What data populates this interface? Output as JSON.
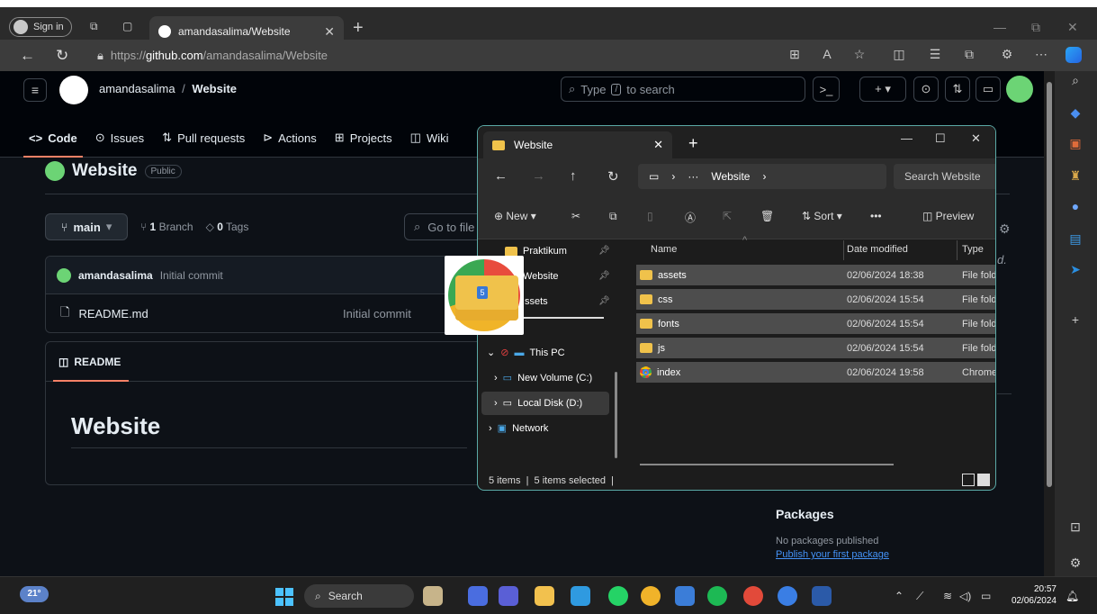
{
  "browser": {
    "sign_in": "Sign in",
    "tab_title": "amandasalima/Website",
    "url_prefix": "https://",
    "url_host": "github.com",
    "url_path": "/amandasalima/Website"
  },
  "github": {
    "owner": "amandasalima",
    "slash": "/",
    "repo": "Website",
    "search_placeholder": "Type",
    "search_kbd": "/",
    "search_suffix": "to search",
    "nav": [
      "Code",
      "Issues",
      "Pull requests",
      "Actions",
      "Projects",
      "Wiki"
    ],
    "visibility": "Public",
    "branch": "main",
    "branches_count": "1",
    "branches_label": "Branch",
    "tags_count": "0",
    "tags_label": "Tags",
    "go_to_file": "Go to file",
    "commit_author": "amandasalima",
    "commit_message": "Initial commit",
    "file_name": "README.md",
    "file_commit": "Initial commit",
    "readme_tab": "README",
    "readme_heading": "Website",
    "packages_title": "Packages",
    "packages_none": "No packages published",
    "packages_link": "Publish your first package",
    "italic_fragment": "d."
  },
  "explorer": {
    "tab_title": "Website",
    "path_sep": "›",
    "path_ellipsis": "···",
    "path_folder": "Website",
    "search_placeholder": "Search Website",
    "toolbar": {
      "new": "New",
      "sort": "Sort",
      "more": "•••",
      "preview": "Preview"
    },
    "tree": {
      "praktikum": "Praktikum",
      "website": "Website",
      "assets": "ssets",
      "this_pc": "This PC",
      "new_volume": "New Volume (C:)",
      "local_disk": "Local Disk (D:)",
      "network": "Network"
    },
    "columns": {
      "name": "Name",
      "date": "Date modified",
      "type": "Type"
    },
    "rows": [
      {
        "name": "assets",
        "date": "02/06/2024 18:38",
        "type": "File fold"
      },
      {
        "name": "css",
        "date": "02/06/2024 15:54",
        "type": "File fold"
      },
      {
        "name": "fonts",
        "date": "02/06/2024 15:54",
        "type": "File fold"
      },
      {
        "name": "js",
        "date": "02/06/2024 15:54",
        "type": "File fold"
      },
      {
        "name": "index",
        "date": "02/06/2024 19:58",
        "type": "Chrome"
      }
    ],
    "status": "5 items  |  5 items selected  |",
    "drag_badge": "5"
  },
  "taskbar": {
    "weather": "21°",
    "search": "Search",
    "time": "20:57",
    "date": "02/06/2024"
  },
  "colors": {
    "accent": "#f78166",
    "link": "#4493f8",
    "explorer_border": "#5aa9a6"
  }
}
